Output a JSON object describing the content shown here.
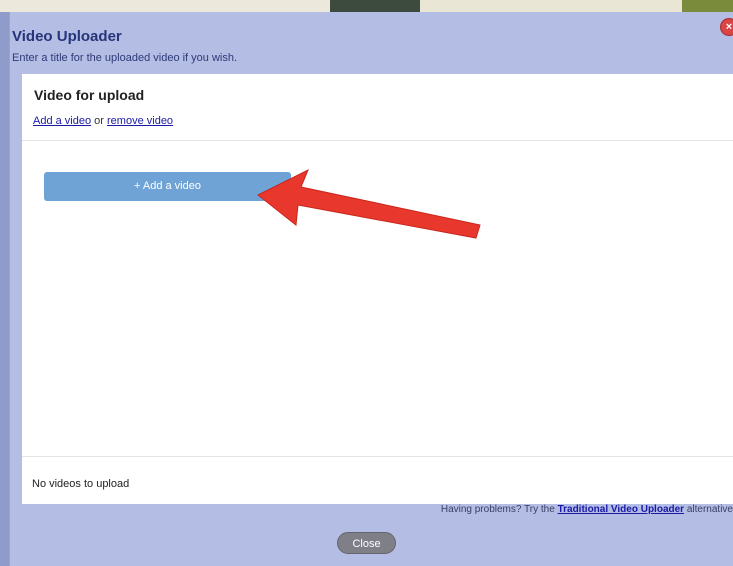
{
  "dialog": {
    "title": "Video Uploader",
    "subtitle": "Enter a title for the uploaded video if you wish.",
    "close_glyph": "×"
  },
  "upload_panel": {
    "heading": "Video for upload",
    "add_link": "Add a video",
    "or_text": " or ",
    "remove_link": "remove video",
    "add_button_label": "+ Add a video",
    "status_text": "No videos to upload"
  },
  "footer": {
    "help_prefix": "Having problems? Try the ",
    "help_link": "Traditional Video Uploader",
    "help_suffix": " alternative",
    "close_button": "Close"
  },
  "colors": {
    "dialog_bg": "#b4bde4",
    "title_text": "#26347a",
    "add_button": "#6fa3d6",
    "annotation_arrow": "#e8382e",
    "close_button": "#7e7f87"
  },
  "icons": {
    "dialog_close": "close-icon",
    "annotation": "red-arrow-icon"
  }
}
